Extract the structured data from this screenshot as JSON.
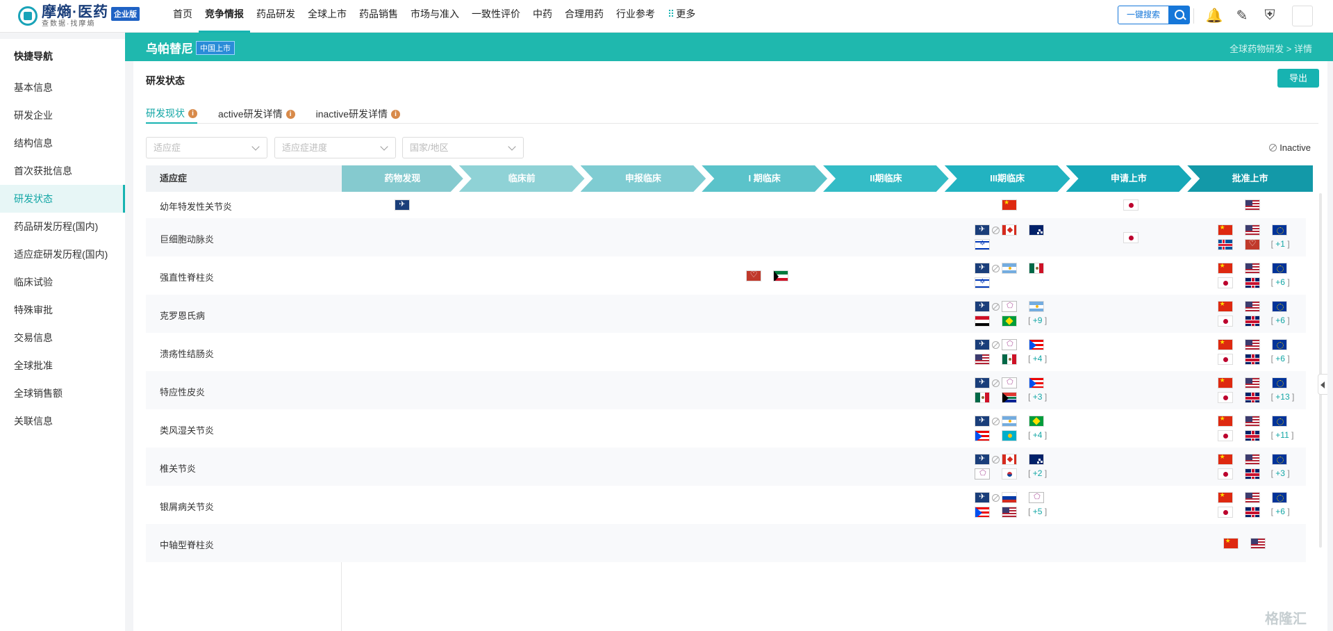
{
  "header": {
    "logo_main": "摩熵·医药",
    "logo_sub": "查数据·找摩熵",
    "edition_badge": "企业版",
    "nav": [
      "首页",
      "竞争情报",
      "药品研发",
      "全球上市",
      "药品销售",
      "市场与准入",
      "一致性评价",
      "中药",
      "合理用药",
      "行业参考"
    ],
    "nav_active": "竞争情报",
    "more_label": "更多",
    "search_label": "一键搜索"
  },
  "sidebar": {
    "title": "快捷导航",
    "items": [
      "基本信息",
      "研发企业",
      "结构信息",
      "首次获批信息",
      "研发状态",
      "药品研发历程(国内)",
      "适应症研发历程(国内)",
      "临床试验",
      "特殊审批",
      "交易信息",
      "全球批准",
      "全球销售额",
      "关联信息"
    ],
    "active": "研发状态"
  },
  "banner": {
    "drug_name": "乌帕替尼",
    "tag": "中国上市",
    "breadcrumb": "全球药物研发 > 详情"
  },
  "section": {
    "title": "研发状态",
    "export_label": "导出",
    "tabs": [
      "研发现状",
      "active研发详情",
      "inactive研发详情"
    ],
    "active_tab": "研发现状",
    "filters": [
      {
        "placeholder": "适应症"
      },
      {
        "placeholder": "适应症进度"
      },
      {
        "placeholder": "国家/地区"
      }
    ],
    "inactive_label": "Inactive"
  },
  "table": {
    "indication_header": "适应症",
    "stages": [
      "药物发现",
      "临床前",
      "申报临床",
      "I 期临床",
      "II期临床",
      "III期临床",
      "申请上市",
      "批准上市"
    ],
    "stage_colors": [
      "#85cacf",
      "#8fd2d6",
      "#7fccd2",
      "#5bc3ca",
      "#34bcc6",
      "#22b3c1",
      "#17a8b8",
      "#1399a8"
    ],
    "rows": [
      {
        "indication": "幼年特发性关节炎",
        "cells": {
          "0": {
            "flags": [
              "ema"
            ]
          },
          "5": {
            "flags": [
              "cn"
            ]
          },
          "6": {
            "flags": [
              "jp"
            ]
          },
          "7": {
            "flags": [
              "us"
            ]
          }
        }
      },
      {
        "indication": "巨细胞动脉炎",
        "cells": {
          "5": {
            "flags": [
              "ema",
              "ca",
              "au",
              "il"
            ],
            "inactive_first": true
          },
          "6": {
            "flags": [
              "jp"
            ]
          },
          "7": {
            "flags": [
              "cn",
              "us",
              "eu",
              "is",
              "hc"
            ],
            "more": "+1"
          }
        }
      },
      {
        "indication": "强直性脊柱炎",
        "cells": {
          "3": {
            "flags": [
              "hc",
              "kw"
            ]
          },
          "5": {
            "flags": [
              "ema",
              "ar",
              "mx",
              "il"
            ],
            "inactive_first": true
          },
          "7": {
            "flags": [
              "cn",
              "us",
              "eu",
              "jp",
              "gb"
            ],
            "more": "+6"
          }
        }
      },
      {
        "indication": "克罗恩氏病",
        "cells": {
          "5": {
            "flags": [
              "ema",
              "tw",
              "ar",
              "eg",
              "br"
            ],
            "inactive_first": true,
            "more": "+9"
          },
          "7": {
            "flags": [
              "cn",
              "us",
              "eu",
              "jp",
              "gb"
            ],
            "more": "+6"
          }
        }
      },
      {
        "indication": "溃疡性结肠炎",
        "cells": {
          "5": {
            "flags": [
              "ema",
              "tw",
              "pr",
              "us",
              "mx"
            ],
            "inactive_first": true,
            "more": "+4"
          },
          "7": {
            "flags": [
              "cn",
              "us",
              "eu",
              "jp",
              "gb"
            ],
            "more": "+6"
          }
        }
      },
      {
        "indication": "特应性皮炎",
        "cells": {
          "5": {
            "flags": [
              "ema",
              "tw",
              "pr",
              "mx",
              "za"
            ],
            "inactive_first": true,
            "more": "+3"
          },
          "7": {
            "flags": [
              "cn",
              "us",
              "eu",
              "jp",
              "gb"
            ],
            "more": "+13"
          }
        }
      },
      {
        "indication": "类风湿关节炎",
        "cells": {
          "5": {
            "flags": [
              "ema",
              "ar",
              "br",
              "pr",
              "kz"
            ],
            "inactive_first": true,
            "more": "+4"
          },
          "7": {
            "flags": [
              "cn",
              "us",
              "eu",
              "jp",
              "gb"
            ],
            "more": "+11"
          }
        }
      },
      {
        "indication": "椎关节炎",
        "cells": {
          "5": {
            "flags": [
              "ema",
              "ca",
              "au",
              "tw",
              "kr"
            ],
            "inactive_first": true,
            "more": "+2"
          },
          "7": {
            "flags": [
              "cn",
              "us",
              "eu",
              "jp",
              "gb"
            ],
            "more": "+3"
          }
        }
      },
      {
        "indication": "银屑病关节炎",
        "cells": {
          "5": {
            "flags": [
              "ema",
              "ru",
              "tw",
              "pr",
              "us"
            ],
            "inactive_first": true,
            "more": "+5"
          },
          "7": {
            "flags": [
              "cn",
              "us",
              "eu",
              "jp",
              "gb"
            ],
            "more": "+6"
          }
        }
      },
      {
        "indication": "中轴型脊柱炎",
        "cells": {
          "7": {
            "flags": [
              "cn",
              "us"
            ],
            "single_row": true
          }
        }
      }
    ]
  },
  "watermark": "格隆汇"
}
